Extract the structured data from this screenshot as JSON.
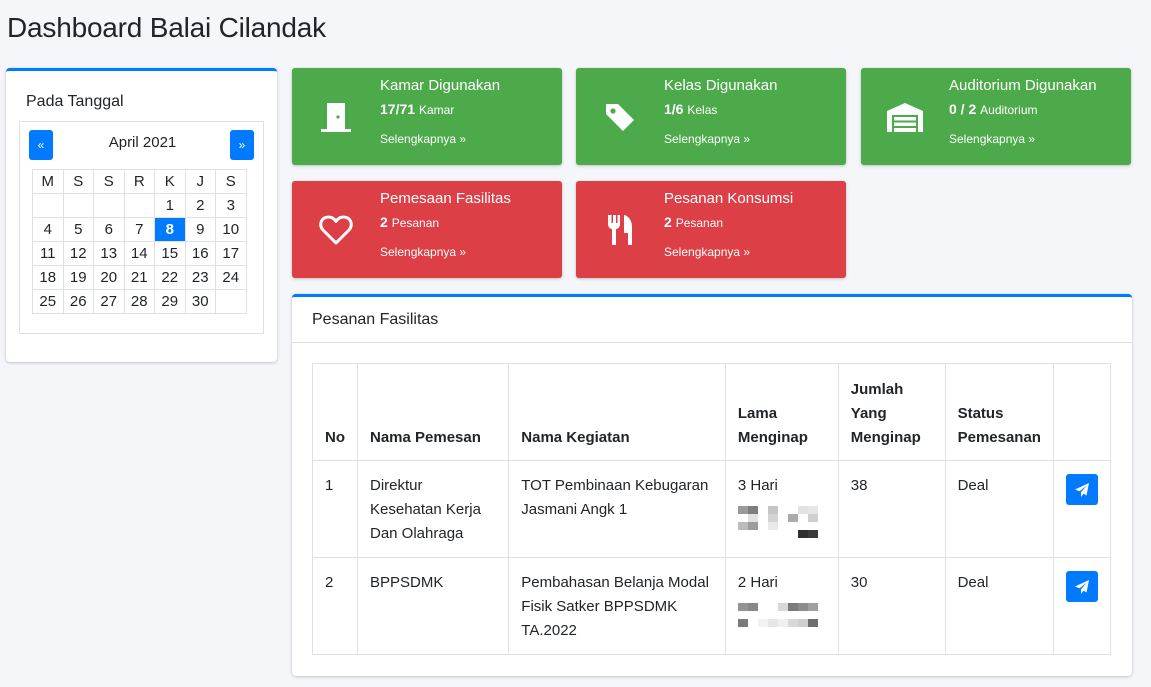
{
  "page": {
    "title": "Dashboard Balai Cilandak"
  },
  "calendar": {
    "card_title": "Pada Tanggal",
    "prev_label": "«",
    "next_label": "»",
    "month_label": "April 2021",
    "weekdays": [
      "M",
      "S",
      "S",
      "R",
      "K",
      "J",
      "S"
    ],
    "weeks": [
      [
        "",
        "",
        "",
        "",
        "1",
        "2",
        "3"
      ],
      [
        "4",
        "5",
        "6",
        "7",
        "8",
        "9",
        "10"
      ],
      [
        "11",
        "12",
        "13",
        "14",
        "15",
        "16",
        "17"
      ],
      [
        "18",
        "19",
        "20",
        "21",
        "22",
        "23",
        "24"
      ],
      [
        "25",
        "26",
        "27",
        "28",
        "29",
        "30",
        ""
      ]
    ],
    "selected_day": "8"
  },
  "stats": [
    {
      "title": "Kamar Digunakan",
      "count": "17/71",
      "unit": "Kamar",
      "link": "Selengkapnya »",
      "icon": "door-icon",
      "color": "green"
    },
    {
      "title": "Kelas Digunakan",
      "count": "1/6",
      "unit": "Kelas",
      "link": "Selengkapnya »",
      "icon": "tag-icon",
      "color": "green"
    },
    {
      "title": "Auditorium Digunakan",
      "count": "0 / 2",
      "unit": "Auditorium",
      "link": "Selengkapnya »",
      "icon": "warehouse-icon",
      "color": "green"
    },
    {
      "title": "Pemesaan Fasilitas",
      "count": "2",
      "unit": "Pesanan",
      "link": "Selengkapnya »",
      "icon": "heart-icon",
      "color": "red"
    },
    {
      "title": "Pesanan Konsumsi",
      "count": "2",
      "unit": "Pesanan",
      "link": "Selengkapnya »",
      "icon": "utensils-icon",
      "color": "red"
    }
  ],
  "colors": {
    "primary": "#007bff",
    "success": "#4caa4a",
    "danger": "#dc3f45"
  },
  "orders": {
    "card_title": "Pesanan Fasilitas",
    "columns": [
      "No",
      "Nama Pemesan",
      "Nama Kegiatan",
      "Lama Menginap",
      "Jumlah Yang Menginap",
      "Status Pemesanan",
      ""
    ],
    "rows": [
      {
        "no": "1",
        "pemesan": "Direktur Kesehatan Kerja Dan Olahraga",
        "kegiatan": "TOT Pembinaan Kebugaran Jasmani Angk 1",
        "lama": "3 Hari",
        "jumlah": "38",
        "status": "Deal",
        "action_icon": "send-icon"
      },
      {
        "no": "2",
        "pemesan": "BPPSDMK",
        "kegiatan": "Pembahasan Belanja Modal Fisik Satker BPPSDMK TA.2022",
        "lama": "2 Hari",
        "jumlah": "30",
        "status": "Deal",
        "action_icon": "send-icon"
      }
    ]
  }
}
